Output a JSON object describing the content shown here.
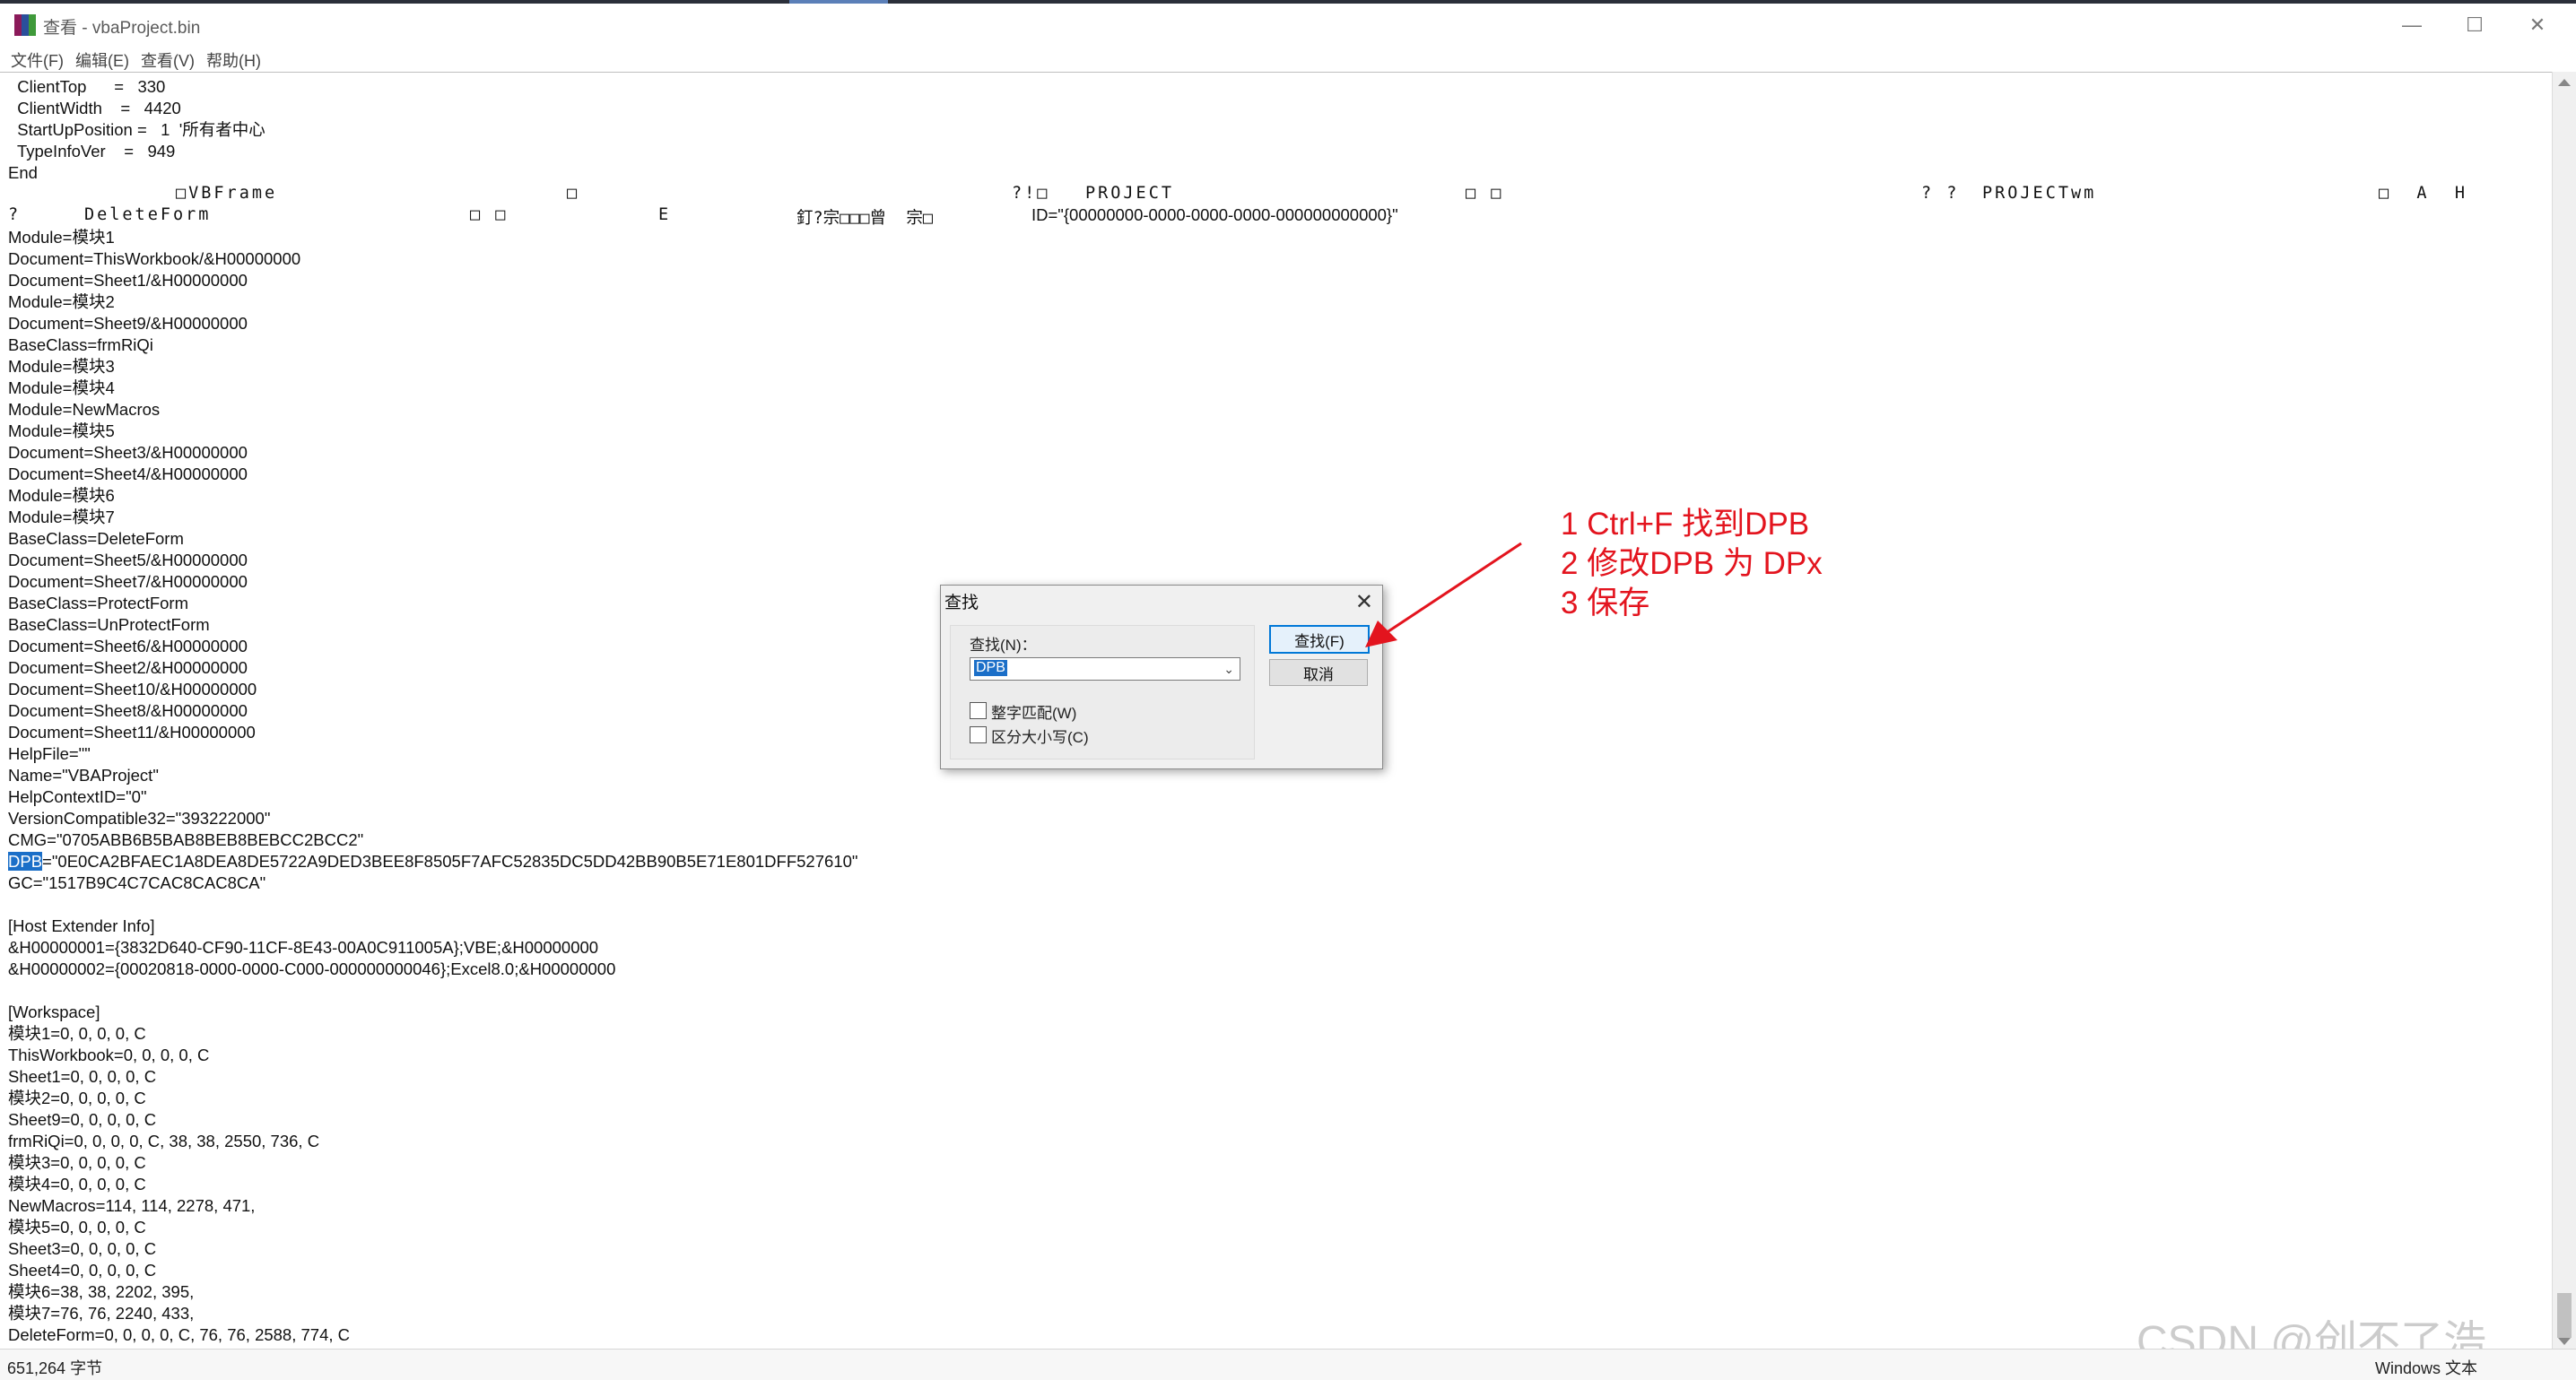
{
  "window": {
    "title": "查看 - vbaProject.bin",
    "controls": [
      "—",
      "☐",
      "✕"
    ]
  },
  "menu": [
    "文件(F)",
    "编辑(E)",
    "查看(V)",
    "帮助(H)"
  ],
  "content_lines": [
    "  ClientTop      =   330",
    "  ClientWidth    =   4420",
    "  StartUpPosition =   1  '所有者中心",
    "  TypeInfoVer    =   949",
    "End",
    "",
    "",
    "Module=模块1",
    "Document=ThisWorkbook/&H00000000",
    "Document=Sheet1/&H00000000",
    "Module=模块2",
    "Document=Sheet9/&H00000000",
    "BaseClass=frmRiQi",
    "Module=模块3",
    "Module=模块4",
    "Module=NewMacros",
    "Module=模块5",
    "Document=Sheet3/&H00000000",
    "Document=Sheet4/&H00000000",
    "Module=模块6",
    "Module=模块7",
    "BaseClass=DeleteForm",
    "Document=Sheet5/&H00000000",
    "Document=Sheet7/&H00000000",
    "BaseClass=ProtectForm",
    "BaseClass=UnProtectForm",
    "Document=Sheet6/&H00000000",
    "Document=Sheet2/&H00000000",
    "Document=Sheet10/&H00000000",
    "Document=Sheet8/&H00000000",
    "Document=Sheet11/&H00000000",
    "HelpFile=\"\"",
    "Name=\"VBAProject\"",
    "HelpContextID=\"0\"",
    "VersionCompatible32=\"393222000\"",
    "CMG=\"0705ABB6B5BAB8BEB8BEBCC2BCC2\"",
    "",
    "GC=\"1517B9C4C7CAC8CAC8CA\"",
    "",
    "[Host Extender Info]",
    "&H00000001={3832D640-CF90-11CF-8E43-00A0C911005A};VBE;&H00000000",
    "&H00000002={00020818-0000-0000-C000-000000000046};Excel8.0;&H00000000",
    "",
    "[Workspace]",
    "模块1=0, 0, 0, 0, C",
    "ThisWorkbook=0, 0, 0, 0, C",
    "Sheet1=0, 0, 0, 0, C",
    "模块2=0, 0, 0, 0, C",
    "Sheet9=0, 0, 0, 0, C",
    "frmRiQi=0, 0, 0, 0, C, 38, 38, 2550, 736, C",
    "模块3=0, 0, 0, 0, C",
    "模块4=0, 0, 0, 0, C",
    "NewMacros=114, 114, 2278, 471,",
    "模块5=0, 0, 0, 0, C",
    "Sheet3=0, 0, 0, 0, C",
    "Sheet4=0, 0, 0, 0, C",
    "模块6=38, 38, 2202, 395,",
    "模块7=76, 76, 2240, 433,",
    "DeleteForm=0, 0, 0, 0, C, 76, 76, 2588, 774, C"
  ],
  "dpb_line": {
    "key": "DPB",
    "rest": "=\"0E0CA2BFAEC1A8DEA8DE5722A9DED3BEE8F8505F7AFC52835DC5DD42BB90B5E71E801DFF527610\""
  },
  "binary_row1": [
    {
      "text": "□VBFrame"
    },
    {
      "text": "□"
    },
    {
      "text": "?!□"
    },
    {
      "text": "PROJECT"
    },
    {
      "text": "□ □"
    },
    {
      "text": "? ?"
    },
    {
      "text": "PROJECTwm"
    },
    {
      "text": "□  A  H"
    }
  ],
  "binary_row2": [
    {
      "text": "?"
    },
    {
      "text": "DeleteForm"
    },
    {
      "text": "□ □"
    },
    {
      "text": "E"
    },
    {
      "text": "釘?宗□□□曾  宗□"
    },
    {
      "text": "ID=\"{00000000-0000-0000-0000-000000000000}\""
    }
  ],
  "find_dialog": {
    "title": "查找",
    "find_label": "查找(N)：",
    "find_value": "DPB",
    "option_whole_word": "整字匹配(W)",
    "option_match_case": "区分大小写(C)",
    "find_button": "查找(F)",
    "cancel_button": "取消"
  },
  "annotation": {
    "line1": "1 Ctrl+F 找到DPB",
    "line2": "2 修改DPB 为 DPx",
    "line3": "3 保存",
    "color": "#e3141e"
  },
  "status": {
    "size": "651,264 字节",
    "encoding": "Windows 文本"
  },
  "watermark": "CSDN @创不了浩"
}
